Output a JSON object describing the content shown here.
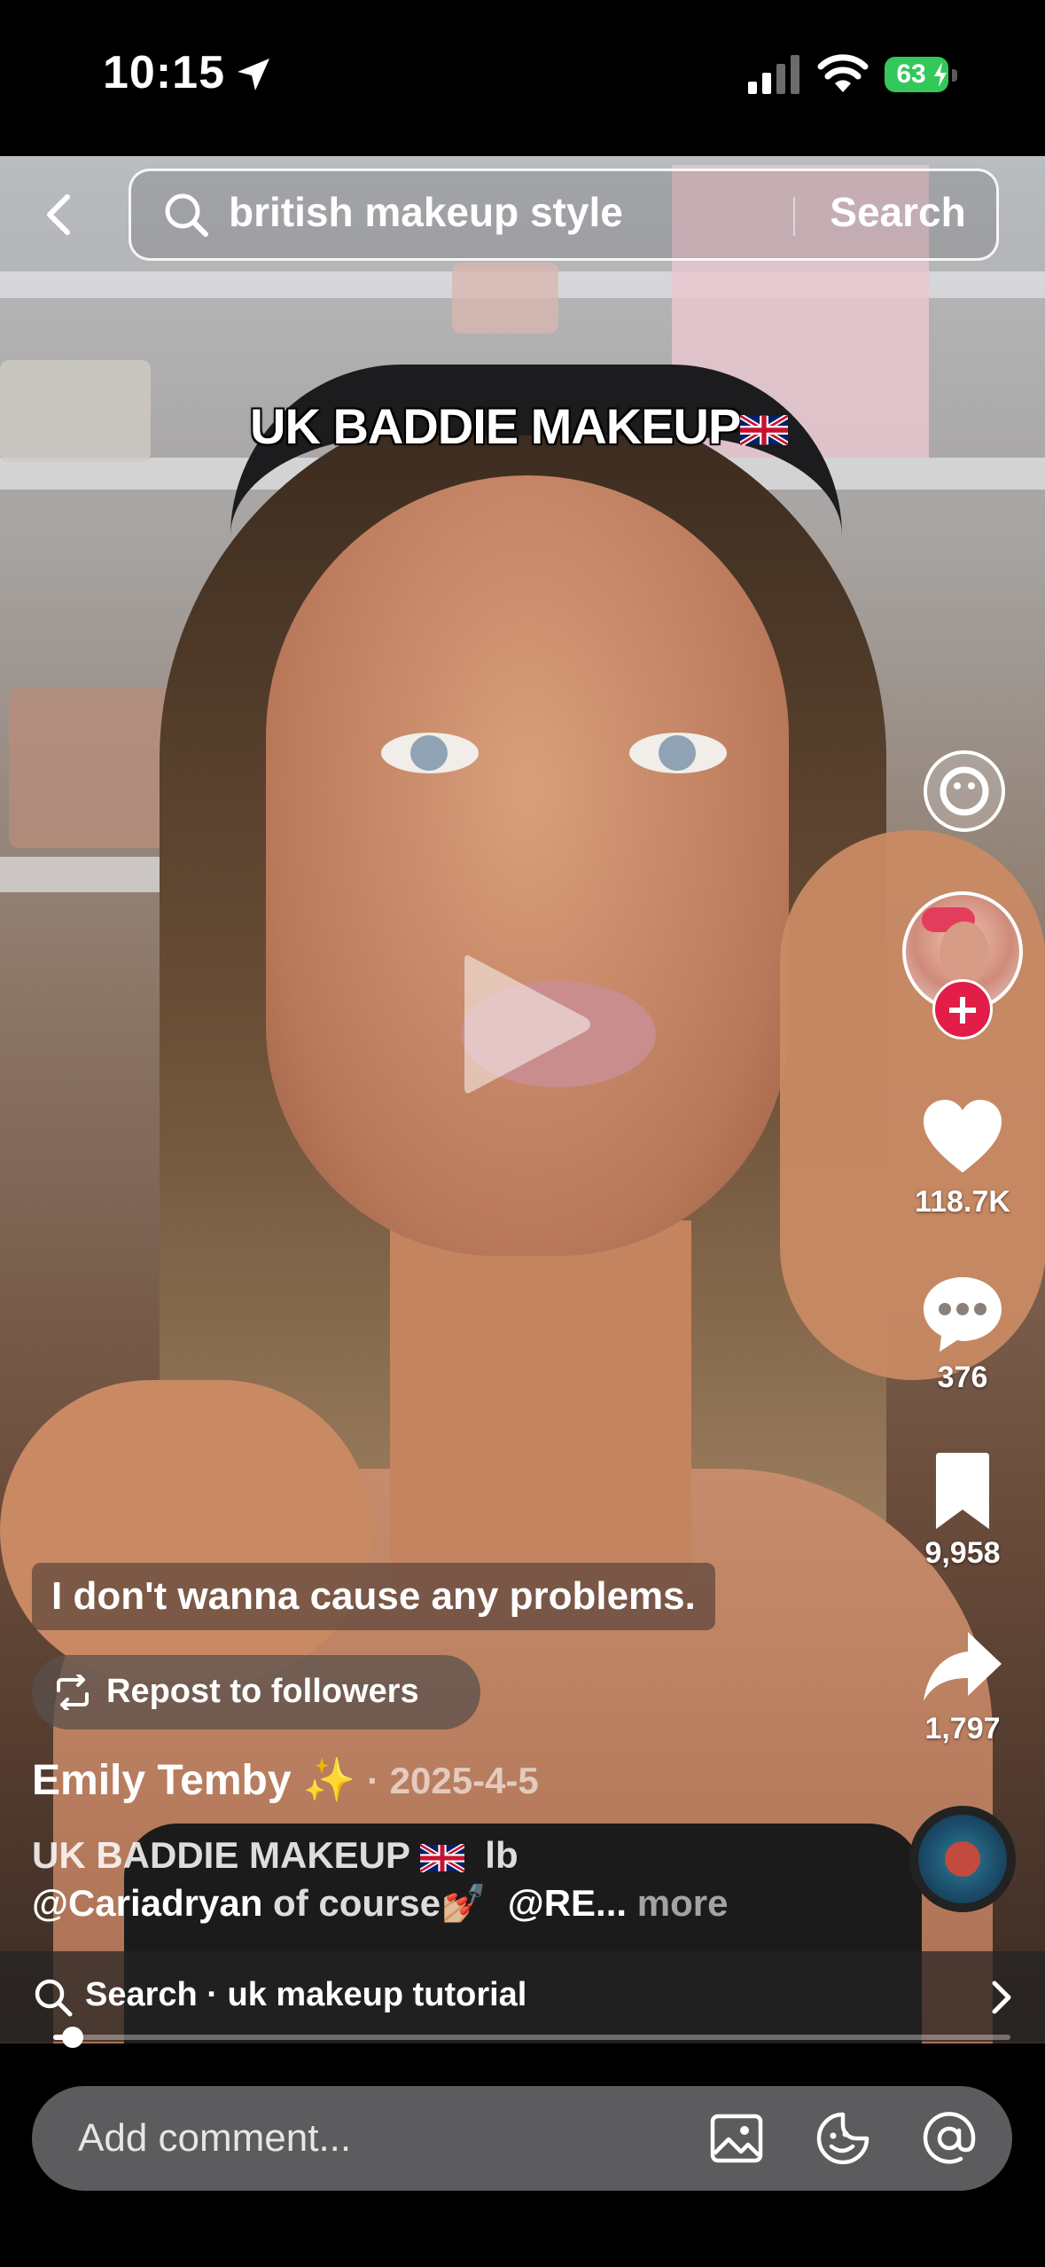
{
  "status_bar": {
    "time": "10:15",
    "battery": "63"
  },
  "search": {
    "query": "british makeup style",
    "button": "Search"
  },
  "video": {
    "overlay_title": "UK BADDIE MAKEUP",
    "caption": "I don't wanna cause any problems."
  },
  "actions": {
    "likes": "118.7K",
    "comments": "376",
    "saves": "9,958",
    "shares": "1,797"
  },
  "repost": {
    "label": "Repost to followers"
  },
  "post": {
    "author": "Emily Temby",
    "date": "· 2025-4-5",
    "desc_line1": "UK BADDIE MAKEUP",
    "desc_line1_suffix": "lb",
    "mention1": "@Cariadryan",
    "desc_mid": " of course",
    "mention2": "@RE...",
    "more": "more"
  },
  "related_search": {
    "label": "Search · uk makeup tutorial"
  },
  "progress": {
    "fraction": 0.02
  },
  "comment": {
    "placeholder": "Add comment..."
  },
  "icons": [
    "back-chevron-icon",
    "search-icon",
    "location-arrow-icon",
    "signal-icon",
    "wifi-icon",
    "battery-icon",
    "play-icon",
    "filter-face-icon",
    "heart-icon",
    "comment-bubble-icon",
    "bookmark-icon",
    "share-arrow-icon",
    "repost-icon",
    "chevron-right-icon",
    "image-icon",
    "emoji-icon",
    "at-icon"
  ],
  "colors": {
    "follow": "#e11d48",
    "battery": "#34c759",
    "comment_bar": "#5c5c5e"
  }
}
